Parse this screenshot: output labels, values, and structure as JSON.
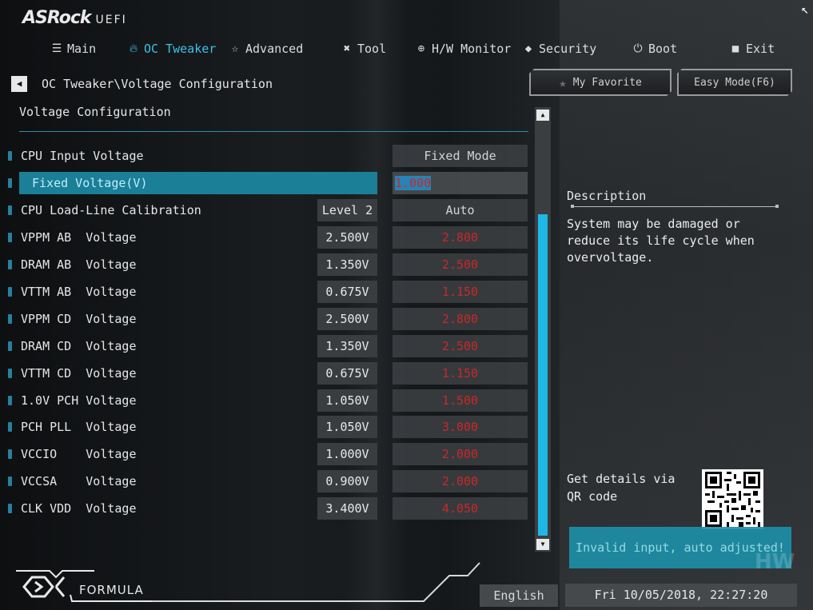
{
  "header": {
    "brand": "ASRock",
    "brand_suffix": "UEFI"
  },
  "nav": [
    {
      "label": "Main",
      "icon": "list-icon"
    },
    {
      "label": "OC Tweaker",
      "icon": "flame-icon",
      "active": true
    },
    {
      "label": "Advanced",
      "icon": "star-icon"
    },
    {
      "label": "Tool",
      "icon": "wrench-icon"
    },
    {
      "label": "H/W Monitor",
      "icon": "monitor-icon"
    },
    {
      "label": "Security",
      "icon": "shield-icon"
    },
    {
      "label": "Boot",
      "icon": "power-icon"
    },
    {
      "label": "Exit",
      "icon": "exit-door-icon"
    }
  ],
  "breadcrumb": "OC Tweaker\\Voltage Configuration",
  "section_title": "Voltage Configuration",
  "buttons": {
    "favorite": "My Favorite",
    "easy_mode": "Easy Mode(F6)"
  },
  "rows": [
    {
      "label": "CPU Input Voltage",
      "current": "",
      "setting": "Fixed Mode",
      "setting_style": "plain"
    },
    {
      "label": "Fixed Voltage(V)",
      "current": "",
      "setting": "1.000",
      "setting_style": "editing",
      "selected": true
    },
    {
      "label": "CPU Load-Line Calibration",
      "current": "Level 2",
      "setting": "Auto",
      "setting_style": "plain"
    },
    {
      "label": "VPPM AB  Voltage",
      "current": "2.500V",
      "setting": "2.800"
    },
    {
      "label": "DRAM AB  Voltage",
      "current": "1.350V",
      "setting": "2.500"
    },
    {
      "label": "VTTM AB  Voltage",
      "current": "0.675V",
      "setting": "1.150"
    },
    {
      "label": "VPPM CD  Voltage",
      "current": "2.500V",
      "setting": "2.800"
    },
    {
      "label": "DRAM CD  Voltage",
      "current": "1.350V",
      "setting": "2.500"
    },
    {
      "label": "VTTM CD  Voltage",
      "current": "0.675V",
      "setting": "1.150"
    },
    {
      "label": "1.0V PCH Voltage",
      "current": "1.050V",
      "setting": "1.500"
    },
    {
      "label": "PCH PLL  Voltage",
      "current": "1.050V",
      "setting": "3.000"
    },
    {
      "label": "VCCIO    Voltage",
      "current": "1.000V",
      "setting": "2.000"
    },
    {
      "label": "VCCSA    Voltage",
      "current": "0.900V",
      "setting": "2.000"
    },
    {
      "label": "CLK VDD  Voltage",
      "current": "3.400V",
      "setting": "4.050"
    }
  ],
  "description": {
    "title": "Description",
    "text": "System may be damaged or reduce its life cycle when overvoltage.",
    "qr_text": "Get details via QR code"
  },
  "toast": "Invalid input, auto adjusted!",
  "watermark": "HW",
  "footer": {
    "brand": "FORMULA",
    "language": "English",
    "datetime": "Fri 10/05/2018, 22:27:20"
  },
  "colors": {
    "accent": "#3fc1e6",
    "selection": "#1a7f97",
    "warning_value": "#dd2a2a",
    "scroll_thumb": "#1db8e6",
    "toast_bg": "#1d8fa6"
  }
}
